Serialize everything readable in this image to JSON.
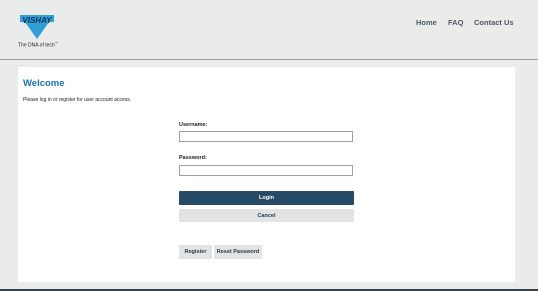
{
  "header": {
    "logo_text": "VISHAY",
    "tagline": "The DNA of tech",
    "tagline_mark": "™",
    "brand_color": "#1a73b6",
    "nav": [
      {
        "label": "Home"
      },
      {
        "label": "FAQ"
      },
      {
        "label": "Contact Us"
      }
    ]
  },
  "main": {
    "title": "Welcome",
    "intro": "Please log in or register for user account access.",
    "username_label": "Username:",
    "username_value": "",
    "password_label": "Password:",
    "password_value": "",
    "login_label": "Login",
    "cancel_label": "Cancel",
    "register_label": "Register",
    "reset_label": "Reset Password"
  },
  "colors": {
    "page_bg": "#eaecec",
    "login_button": "#264b66",
    "secondary_button": "#e1e3e4",
    "title_color": "#1a73b6"
  }
}
